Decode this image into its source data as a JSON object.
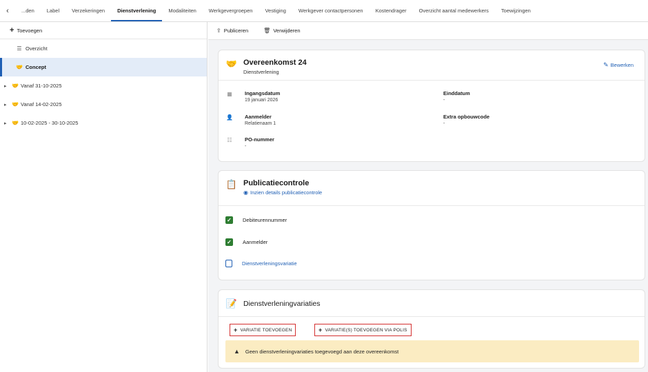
{
  "tabs": {
    "back_icon": "chevron-left-icon",
    "items": [
      {
        "label": "...den"
      },
      {
        "label": "Label"
      },
      {
        "label": "Verzekeringen"
      },
      {
        "label": "Dienstverlening"
      },
      {
        "label": "Modaliteiten"
      },
      {
        "label": "Werkgevergroepen"
      },
      {
        "label": "Vestiging"
      },
      {
        "label": "Werkgever contactpersonen"
      },
      {
        "label": "Kostendrager"
      },
      {
        "label": "Overzicht aantal medewerkers"
      },
      {
        "label": "Toewijzingen"
      }
    ],
    "active_index": 3
  },
  "sidebar": {
    "add_label": "Toevoegen",
    "items": [
      {
        "label": "Overzicht",
        "icon": "list-icon"
      },
      {
        "label": "Concept",
        "icon": "handshake-icon"
      }
    ],
    "tree": [
      {
        "label": "Vanaf 31-10-2025",
        "icon": "handshake-icon"
      },
      {
        "label": "Vanaf 14-02-2025",
        "icon": "handshake-icon"
      },
      {
        "label": "10-02-2025 - 30-10-2025",
        "icon": "handshake-icon"
      }
    ]
  },
  "toolbar": {
    "publish_label": "Publiceren",
    "delete_label": "Verwijderen"
  },
  "agreement": {
    "title": "Overeenkomst 24",
    "subtitle": "Dienstverlening",
    "edit_label": "Bewerken",
    "start_label": "Ingangsdatum",
    "start_value": "19 januari 2026",
    "end_label": "Einddatum",
    "end_value": "-",
    "applicant_label": "Aanmelder",
    "applicant_value": "Relatienaam 1",
    "extra_label": "Extra opbouwcode",
    "extra_value": "-",
    "po_label": "PO-nummer",
    "po_value": "-"
  },
  "publication": {
    "title": "Publicatiecontrole",
    "details_link": "Inzien details publicatiecontrole",
    "checks": [
      {
        "label": "Debiteurennummer",
        "checked": true
      },
      {
        "label": "Aanmelder",
        "checked": true
      },
      {
        "label": "Dienstverleningsvariatie",
        "checked": false
      }
    ]
  },
  "variations": {
    "title": "Dienstverleningvariaties",
    "add_button": "VARIATIE TOEVOEGEN",
    "add_policy_button": "VARIATIE(S) TOEVOEGEN VIA POLIS",
    "warning": "Geen dienstverleningvariaties toegevoegd aan deze overeenkomst"
  },
  "colors": {
    "accent": "#1f5fb4",
    "check": "#2e7d32",
    "warning_bg": "#fbecc2",
    "highlight_border": "#d32f2f"
  }
}
